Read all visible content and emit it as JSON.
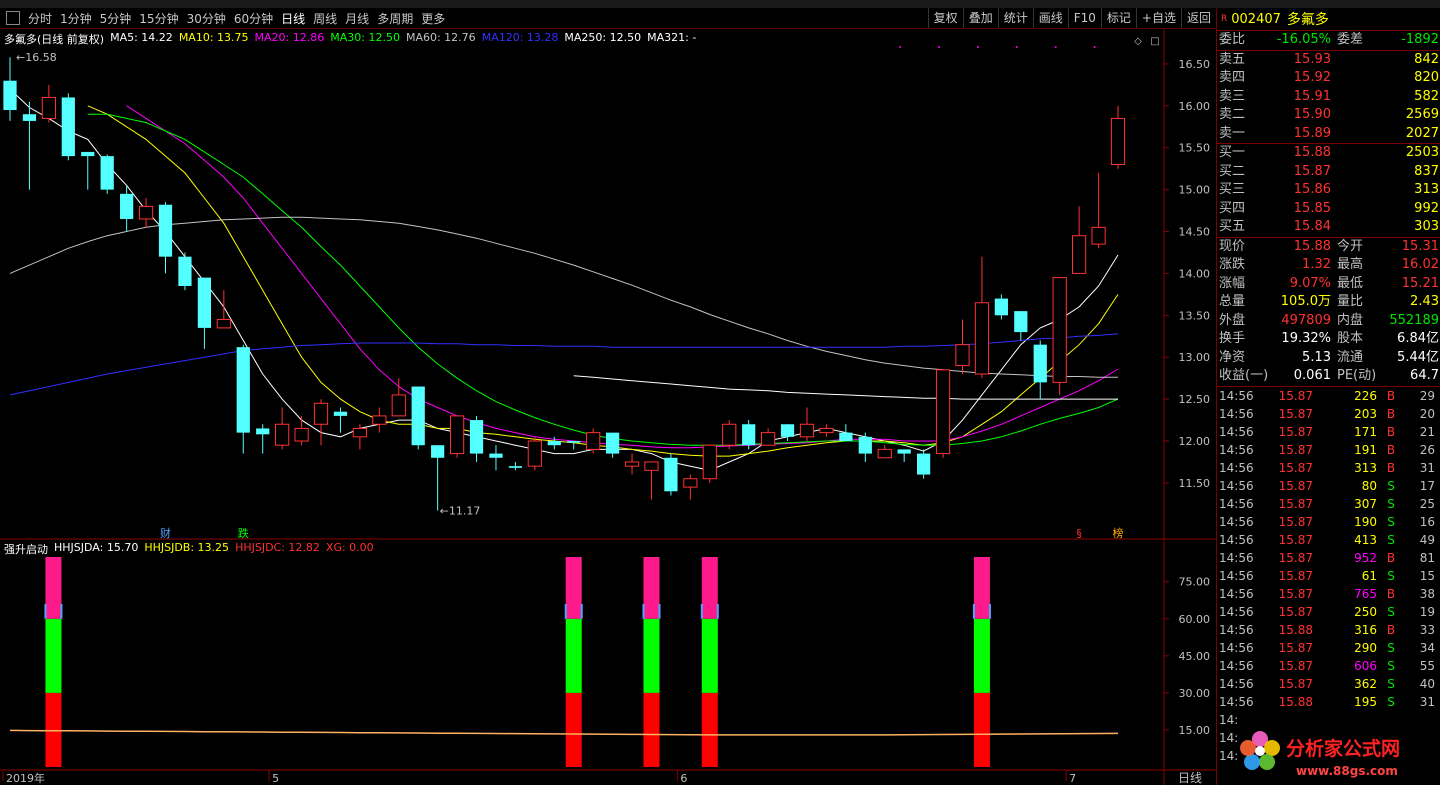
{
  "toolbar": {
    "items": [
      "分时",
      "1分钟",
      "5分钟",
      "15分钟",
      "30分钟",
      "60分钟",
      "日线",
      "周线",
      "月线",
      "多周期",
      "更多"
    ],
    "active": "日线",
    "right_buttons": [
      "复权",
      "叠加",
      "统计",
      "画线",
      "F10",
      "标记",
      "+自选",
      "返回"
    ]
  },
  "chart_header": {
    "title": "多氟多(日线 前复权)",
    "ma": [
      {
        "label": "MA5: 14.22",
        "color": "#ffffff"
      },
      {
        "label": "MA10: 13.75",
        "color": "#ffff00"
      },
      {
        "label": "MA20: 12.86",
        "color": "#ff00ff"
      },
      {
        "label": "MA30: 12.50",
        "color": "#00ff00"
      },
      {
        "label": "MA60: 12.76",
        "color": "#c0c0c0"
      },
      {
        "label": "MA120: 13.28",
        "color": "#3030ff"
      },
      {
        "label": "MA250: 12.50",
        "color": "#ffffff"
      },
      {
        "label": "MA321: -",
        "color": "#ffffff"
      }
    ]
  },
  "price_axis": [
    "16.50",
    "16.00",
    "15.50",
    "15.00",
    "14.50",
    "14.00",
    "13.50",
    "13.00",
    "12.50",
    "12.00",
    "11.50"
  ],
  "annotations": {
    "high": "16.58",
    "low": "11.17",
    "markers": [
      "财",
      "跌",
      "§",
      "榜"
    ]
  },
  "indicator": {
    "name": "强升启动",
    "values": [
      {
        "label": "HHJSJDA: 15.70",
        "color": "#ffffff"
      },
      {
        "label": "HHJSJDB: 13.25",
        "color": "#ffff00"
      },
      {
        "label": "HHJSJDC: 12.82",
        "color": "#ff3232"
      },
      {
        "label": "XG: 0.00",
        "color": "#ff3232"
      }
    ],
    "axis": [
      "75.00",
      "60.00",
      "45.00",
      "30.00",
      "15.00"
    ]
  },
  "date_axis": [
    "2019年",
    "5",
    "6",
    "7"
  ],
  "period_label": "日线",
  "chart_data": {
    "type": "candlestick",
    "ylim": [
      10.95,
      16.75
    ],
    "candles": [
      [
        16.3,
        15.95,
        16.58,
        15.82
      ],
      [
        15.9,
        15.82,
        16.05,
        15.0
      ],
      [
        15.85,
        16.1,
        16.25,
        15.8
      ],
      [
        16.1,
        15.4,
        16.15,
        15.35
      ],
      [
        15.45,
        15.4,
        15.45,
        15.0
      ],
      [
        15.4,
        15.0,
        15.42,
        14.95
      ],
      [
        14.95,
        14.65,
        15.05,
        14.5
      ],
      [
        14.65,
        14.8,
        14.9,
        14.55
      ],
      [
        14.82,
        14.2,
        14.85,
        14.0
      ],
      [
        14.2,
        13.85,
        14.25,
        13.8
      ],
      [
        13.95,
        13.35,
        13.95,
        13.1
      ],
      [
        13.35,
        13.45,
        13.8,
        13.4
      ],
      [
        13.12,
        12.1,
        13.15,
        11.85
      ],
      [
        12.15,
        12.08,
        12.2,
        11.85
      ],
      [
        11.95,
        12.2,
        12.4,
        11.9
      ],
      [
        12.0,
        12.15,
        12.3,
        11.95
      ],
      [
        12.2,
        12.45,
        12.5,
        11.95
      ],
      [
        12.35,
        12.3,
        12.4,
        12.1
      ],
      [
        12.05,
        12.15,
        12.2,
        11.9
      ],
      [
        12.2,
        12.3,
        12.4,
        12.1
      ],
      [
        12.3,
        12.55,
        12.75,
        12.3
      ],
      [
        12.65,
        11.95,
        12.65,
        11.9
      ],
      [
        11.95,
        11.8,
        11.95,
        11.17
      ],
      [
        11.85,
        12.3,
        12.3,
        11.8
      ],
      [
        12.25,
        11.85,
        12.3,
        11.75
      ],
      [
        11.85,
        11.8,
        11.95,
        11.65
      ],
      [
        11.7,
        11.68,
        11.75,
        11.65
      ],
      [
        11.7,
        12.0,
        12.05,
        11.65
      ],
      [
        12.0,
        11.95,
        12.05,
        11.9
      ],
      [
        12.0,
        11.98,
        12.0,
        11.9
      ],
      [
        11.9,
        12.1,
        12.15,
        11.85
      ],
      [
        12.1,
        11.85,
        12.1,
        11.8
      ],
      [
        11.7,
        11.75,
        11.85,
        11.6
      ],
      [
        11.65,
        11.75,
        11.75,
        11.3
      ],
      [
        11.8,
        11.4,
        11.85,
        11.35
      ],
      [
        11.45,
        11.55,
        11.6,
        11.3
      ],
      [
        11.55,
        11.95,
        11.95,
        11.5
      ],
      [
        11.95,
        12.2,
        12.25,
        11.9
      ],
      [
        12.2,
        11.95,
        12.25,
        11.9
      ],
      [
        11.95,
        12.1,
        12.15,
        11.95
      ],
      [
        12.2,
        12.05,
        12.2,
        12.0
      ],
      [
        12.05,
        12.2,
        12.4,
        12.0
      ],
      [
        12.1,
        12.15,
        12.2,
        12.05
      ],
      [
        12.1,
        12.0,
        12.2,
        12.0
      ],
      [
        12.05,
        11.85,
        12.1,
        11.75
      ],
      [
        11.8,
        11.9,
        11.95,
        11.8
      ],
      [
        11.9,
        11.85,
        11.9,
        11.75
      ],
      [
        11.85,
        11.6,
        11.9,
        11.55
      ],
      [
        11.85,
        12.85,
        12.85,
        11.8
      ],
      [
        12.9,
        13.15,
        13.45,
        12.8
      ],
      [
        12.8,
        13.65,
        14.2,
        12.75
      ],
      [
        13.7,
        13.5,
        13.75,
        13.45
      ],
      [
        13.55,
        13.3,
        13.55,
        13.2
      ],
      [
        13.15,
        12.7,
        13.2,
        12.5
      ],
      [
        12.7,
        13.95,
        13.95,
        12.55
      ],
      [
        14.0,
        14.45,
        14.8,
        14.0
      ],
      [
        14.35,
        14.55,
        15.2,
        14.3
      ],
      [
        15.3,
        15.85,
        16.0,
        15.25
      ]
    ],
    "ma_lines": {
      "MA5": [
        16.2,
        15.98,
        15.85,
        15.7,
        15.6,
        15.3,
        15.05,
        14.75,
        14.5,
        14.2,
        13.9,
        13.6,
        13.2,
        12.8,
        12.5,
        12.25,
        12.1,
        12.05,
        12.15,
        12.2,
        12.25,
        12.25,
        12.15,
        12.1,
        12.05,
        12.0,
        11.95,
        11.9,
        11.85,
        11.85,
        11.9,
        11.9,
        11.9,
        11.85,
        11.75,
        11.7,
        11.65,
        11.75,
        11.85,
        12.0,
        12.05,
        12.1,
        12.15,
        12.1,
        12.05,
        12.0,
        11.95,
        11.88,
        12.0,
        12.25,
        12.55,
        12.85,
        13.15,
        13.35,
        13.45,
        13.6,
        13.85,
        14.22
      ],
      "MA10": [
        null,
        null,
        null,
        null,
        16.0,
        15.9,
        15.75,
        15.6,
        15.4,
        15.2,
        14.9,
        14.6,
        14.2,
        13.8,
        13.4,
        13.0,
        12.7,
        12.5,
        12.35,
        12.25,
        12.2,
        12.2,
        12.15,
        12.15,
        12.1,
        12.08,
        12.05,
        12.02,
        12.0,
        11.98,
        11.95,
        11.93,
        11.9,
        11.88,
        11.85,
        11.83,
        11.82,
        11.82,
        11.85,
        11.88,
        11.92,
        11.95,
        11.98,
        12.0,
        12.0,
        12.0,
        11.98,
        11.95,
        11.98,
        12.05,
        12.2,
        12.35,
        12.55,
        12.75,
        12.95,
        13.15,
        13.4,
        13.75
      ],
      "MA20": [
        null,
        null,
        null,
        null,
        null,
        null,
        16.0,
        15.85,
        15.7,
        15.55,
        15.35,
        15.15,
        14.9,
        14.6,
        14.3,
        14.0,
        13.7,
        13.4,
        13.1,
        12.85,
        12.65,
        12.5,
        12.4,
        12.3,
        12.22,
        12.15,
        12.1,
        12.05,
        12.02,
        12.0,
        11.98,
        11.96,
        11.95,
        11.93,
        11.92,
        11.92,
        11.93,
        11.94,
        11.95,
        11.96,
        11.97,
        11.98,
        12.0,
        12.02,
        12.02,
        12.02,
        12.0,
        12.0,
        12.0,
        12.05,
        12.12,
        12.2,
        12.3,
        12.4,
        12.5,
        12.6,
        12.72,
        12.86
      ],
      "MA30": [
        null,
        null,
        null,
        null,
        15.9,
        15.9,
        15.85,
        15.8,
        15.7,
        15.6,
        15.45,
        15.3,
        15.15,
        14.95,
        14.75,
        14.55,
        14.32,
        14.1,
        13.85,
        13.6,
        13.35,
        13.12,
        12.92,
        12.75,
        12.6,
        12.47,
        12.37,
        12.28,
        12.2,
        12.13,
        12.07,
        12.03,
        12.0,
        11.98,
        11.96,
        11.95,
        11.95,
        11.95,
        11.96,
        11.97,
        11.98,
        11.99,
        12.0,
        12.0,
        12.0,
        11.98,
        11.96,
        11.95,
        11.95,
        11.97,
        12.0,
        12.05,
        12.12,
        12.2,
        12.27,
        12.33,
        12.4,
        12.5
      ],
      "MA60": [
        14.0,
        14.1,
        14.2,
        14.3,
        14.38,
        14.45,
        14.5,
        14.55,
        14.58,
        14.6,
        14.62,
        14.64,
        14.65,
        14.66,
        14.67,
        14.67,
        14.66,
        14.65,
        14.64,
        14.62,
        14.6,
        14.56,
        14.52,
        14.47,
        14.42,
        14.36,
        14.3,
        14.24,
        14.17,
        14.1,
        14.02,
        13.94,
        13.86,
        13.77,
        13.68,
        13.6,
        13.51,
        13.43,
        13.35,
        13.28,
        13.2,
        13.13,
        13.07,
        13.02,
        12.97,
        12.93,
        12.9,
        12.87,
        12.85,
        12.83,
        12.81,
        12.8,
        12.79,
        12.78,
        12.77,
        12.77,
        12.76,
        12.76
      ],
      "MA120": [
        12.55,
        12.6,
        12.65,
        12.7,
        12.75,
        12.8,
        12.84,
        12.88,
        12.92,
        12.96,
        13.0,
        13.04,
        13.08,
        13.1,
        13.12,
        13.14,
        13.15,
        13.16,
        13.17,
        13.17,
        13.17,
        13.17,
        13.16,
        13.16,
        13.15,
        13.15,
        13.14,
        13.14,
        13.13,
        13.13,
        13.13,
        13.12,
        13.12,
        13.12,
        13.12,
        13.12,
        13.12,
        13.12,
        13.12,
        13.12,
        13.12,
        13.12,
        13.12,
        13.12,
        13.12,
        13.12,
        13.13,
        13.13,
        13.14,
        13.15,
        13.16,
        13.18,
        13.2,
        13.22,
        13.23,
        13.25,
        13.26,
        13.28
      ],
      "MA250": [
        null,
        null,
        null,
        null,
        null,
        null,
        null,
        null,
        null,
        null,
        null,
        null,
        null,
        null,
        null,
        null,
        null,
        null,
        null,
        null,
        null,
        null,
        null,
        null,
        null,
        null,
        null,
        null,
        null,
        12.78,
        12.76,
        12.74,
        12.72,
        12.7,
        12.68,
        12.66,
        12.64,
        12.62,
        12.61,
        12.6,
        12.58,
        12.57,
        12.56,
        12.55,
        12.54,
        12.53,
        12.52,
        12.51,
        12.51,
        12.5,
        12.5,
        12.5,
        12.5,
        12.5,
        12.5,
        12.5,
        12.5,
        12.5
      ]
    },
    "indicator_bars": [
      {
        "candle": 1,
        "value": 75
      },
      {
        "candle": 29,
        "value": 75
      },
      {
        "candle": 33,
        "value": 75
      },
      {
        "candle": 36,
        "value": 75
      },
      {
        "candle": 50,
        "value": 75
      }
    ],
    "indicator_line": [
      14.8,
      14.75,
      14.7,
      14.65,
      14.6,
      14.55,
      14.5,
      14.45,
      14.4,
      14.35,
      14.3,
      14.25,
      14.2,
      14.15,
      14.1,
      14.05,
      14.0,
      13.95,
      13.9,
      13.85,
      13.8,
      13.75,
      13.7,
      13.65,
      13.6,
      13.55,
      13.5,
      13.45,
      13.4,
      13.35,
      13.3,
      13.25,
      13.2,
      13.15,
      13.1,
      13.05,
      13.0,
      13.0,
      13.0,
      13.0,
      13.0,
      13.0,
      13.0,
      13.0,
      13.0,
      13.0,
      13.05,
      13.1,
      13.15,
      13.2,
      13.25,
      13.3,
      13.35,
      13.4,
      13.45,
      13.5,
      13.55,
      13.6
    ],
    "indicator_ylim": [
      0,
      85
    ]
  },
  "quote": {
    "code": "002407",
    "name": "多氟多",
    "weibi": {
      "label": "委比",
      "value": "-16.05%",
      "label2": "委差",
      "value2": "-1892"
    },
    "sell": [
      {
        "label": "卖五",
        "price": "15.93",
        "vol": "842"
      },
      {
        "label": "卖四",
        "price": "15.92",
        "vol": "820"
      },
      {
        "label": "卖三",
        "price": "15.91",
        "vol": "582"
      },
      {
        "label": "卖二",
        "price": "15.90",
        "vol": "2569"
      },
      {
        "label": "卖一",
        "price": "15.89",
        "vol": "2027"
      }
    ],
    "buy": [
      {
        "label": "买一",
        "price": "15.88",
        "vol": "2503"
      },
      {
        "label": "买二",
        "price": "15.87",
        "vol": "837"
      },
      {
        "label": "买三",
        "price": "15.86",
        "vol": "313"
      },
      {
        "label": "买四",
        "price": "15.85",
        "vol": "992"
      },
      {
        "label": "买五",
        "price": "15.84",
        "vol": "303"
      }
    ],
    "stats": [
      {
        "l1": "现价",
        "v1": "15.88",
        "c1": "red",
        "l2": "今开",
        "v2": "15.31",
        "c2": "red"
      },
      {
        "l1": "涨跌",
        "v1": "1.32",
        "c1": "red",
        "l2": "最高",
        "v2": "16.02",
        "c2": "red"
      },
      {
        "l1": "涨幅",
        "v1": "9.07%",
        "c1": "red",
        "l2": "最低",
        "v2": "15.21",
        "c2": "red"
      },
      {
        "l1": "总量",
        "v1": "105.0万",
        "c1": "yellow",
        "l2": "量比",
        "v2": "2.43",
        "c2": "yellow"
      },
      {
        "l1": "外盘",
        "v1": "497809",
        "c1": "red",
        "l2": "内盘",
        "v2": "552189",
        "c2": "green"
      },
      {
        "l1": "换手",
        "v1": "19.32%",
        "c1": "white",
        "l2": "股本",
        "v2": "6.84亿",
        "c2": "white"
      },
      {
        "l1": "净资",
        "v1": "5.13",
        "c1": "white",
        "l2": "流通",
        "v2": "5.44亿",
        "c2": "white"
      },
      {
        "l1": "收益(一)",
        "v1": "0.061",
        "c1": "white",
        "l2": "PE(动)",
        "v2": "64.7",
        "c2": "white"
      }
    ],
    "ticks": [
      {
        "t": "14:56",
        "p": "15.87",
        "v": "226",
        "vc": "yellow",
        "d": "B",
        "n": "29"
      },
      {
        "t": "14:56",
        "p": "15.87",
        "v": "203",
        "vc": "yellow",
        "d": "B",
        "n": "20"
      },
      {
        "t": "14:56",
        "p": "15.87",
        "v": "171",
        "vc": "yellow",
        "d": "B",
        "n": "21"
      },
      {
        "t": "14:56",
        "p": "15.87",
        "v": "191",
        "vc": "yellow",
        "d": "B",
        "n": "26"
      },
      {
        "t": "14:56",
        "p": "15.87",
        "v": "313",
        "vc": "yellow",
        "d": "B",
        "n": "31"
      },
      {
        "t": "14:56",
        "p": "15.87",
        "v": "80",
        "vc": "yellow",
        "d": "S",
        "n": "17"
      },
      {
        "t": "14:56",
        "p": "15.87",
        "v": "307",
        "vc": "yellow",
        "d": "S",
        "n": "25"
      },
      {
        "t": "14:56",
        "p": "15.87",
        "v": "190",
        "vc": "yellow",
        "d": "S",
        "n": "16"
      },
      {
        "t": "14:56",
        "p": "15.87",
        "v": "413",
        "vc": "yellow",
        "d": "S",
        "n": "49"
      },
      {
        "t": "14:56",
        "p": "15.87",
        "v": "952",
        "vc": "magenta",
        "d": "B",
        "n": "81"
      },
      {
        "t": "14:56",
        "p": "15.87",
        "v": "61",
        "vc": "yellow",
        "d": "S",
        "n": "15"
      },
      {
        "t": "14:56",
        "p": "15.87",
        "v": "765",
        "vc": "magenta",
        "d": "B",
        "n": "38"
      },
      {
        "t": "14:56",
        "p": "15.87",
        "v": "250",
        "vc": "yellow",
        "d": "S",
        "n": "19"
      },
      {
        "t": "14:56",
        "p": "15.88",
        "v": "316",
        "vc": "yellow",
        "d": "B",
        "n": "33"
      },
      {
        "t": "14:56",
        "p": "15.87",
        "v": "290",
        "vc": "yellow",
        "d": "S",
        "n": "34"
      },
      {
        "t": "14:56",
        "p": "15.87",
        "v": "606",
        "vc": "magenta",
        "d": "S",
        "n": "55"
      },
      {
        "t": "14:56",
        "p": "15.87",
        "v": "362",
        "vc": "yellow",
        "d": "S",
        "n": "40"
      },
      {
        "t": "14:56",
        "p": "15.88",
        "v": "195",
        "vc": "yellow",
        "d": "S",
        "n": "31"
      },
      {
        "t": "14:",
        "p": "",
        "v": "",
        "vc": "yellow",
        "d": "",
        "n": ""
      },
      {
        "t": "14:",
        "p": "",
        "v": "",
        "vc": "yellow",
        "d": "",
        "n": ""
      },
      {
        "t": "14:",
        "p": "",
        "v": "",
        "vc": "yellow",
        "d": "",
        "n": ""
      }
    ]
  },
  "watermark": {
    "text": "分析家公式网",
    "url": "www.88gs.com"
  }
}
